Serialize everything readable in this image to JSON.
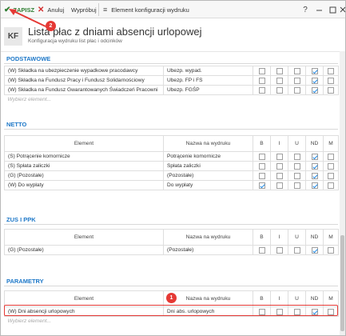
{
  "toolbar": {
    "save": "ZAPISZ",
    "cancel": "Anuluj",
    "try": "Wypróbuj",
    "window_title": "Element konfiguracji wydruku",
    "help": "?"
  },
  "header": {
    "badge": "KF",
    "title": "Lista płac z dniami absencji urlopowej",
    "subtitle": "Konfiguracja wydruku list płac i odcinków"
  },
  "columns": {
    "element": "Element",
    "print_name": "Nazwa na wydruku",
    "b": "B",
    "i": "I",
    "u": "U",
    "nd": "ND",
    "m": "M"
  },
  "placeholder": "Wybierz element...",
  "sections": {
    "podstawowe": {
      "title": "PODSTAWOWE",
      "rows": [
        {
          "element": "(W) Składka na ubezpieczenie wypadkowe pracodawcy",
          "name": "Ubezp. wypad.",
          "b": false,
          "i": false,
          "u": false,
          "nd": true,
          "m": false
        },
        {
          "element": "(W) Składka na Fundusz Pracy i Fundusz Solidarnościowy",
          "name": "Ubezp. FP i FS",
          "b": false,
          "i": false,
          "u": false,
          "nd": true,
          "m": false
        },
        {
          "element": "(W) Składka na Fundusz Gwarantowanych Świadczeń Pracowni",
          "name": "Ubezp. FGŚP",
          "b": false,
          "i": false,
          "u": false,
          "nd": true,
          "m": false
        }
      ]
    },
    "netto": {
      "title": "NETTO",
      "rows": [
        {
          "element": "(S) Potrącenie komornicze",
          "name": "Potrącenie komornicze",
          "b": false,
          "i": false,
          "u": false,
          "nd": true,
          "m": false
        },
        {
          "element": "(S) Spłata zaliczki",
          "name": "Spłata zaliczki",
          "b": false,
          "i": false,
          "u": false,
          "nd": true,
          "m": false
        },
        {
          "element": "(G) (Pozostałe)",
          "name": "(Pozostałe)",
          "b": false,
          "i": false,
          "u": false,
          "nd": true,
          "m": false
        },
        {
          "element": "(W) Do wypłaty",
          "name": "Do wypłaty",
          "b": true,
          "i": false,
          "u": false,
          "nd": true,
          "m": false
        }
      ]
    },
    "zus": {
      "title": "ZUS I PPK",
      "rows": [
        {
          "element": "(G) (Pozostałe)",
          "name": "(Pozostałe)",
          "b": false,
          "i": false,
          "u": false,
          "nd": true,
          "m": false
        }
      ]
    },
    "parametry": {
      "title": "PARAMETRY",
      "rows": [
        {
          "element": "(W) Dni absencji urlopowych",
          "name": "Dni abs. urlopowych",
          "b": false,
          "i": false,
          "u": false,
          "nd": true,
          "m": false
        }
      ]
    }
  },
  "annotations": {
    "one": "1",
    "two": "2"
  },
  "colors": {
    "accent": "#1e78c8",
    "annotation": "#e53935",
    "check": "#1e88e5"
  }
}
